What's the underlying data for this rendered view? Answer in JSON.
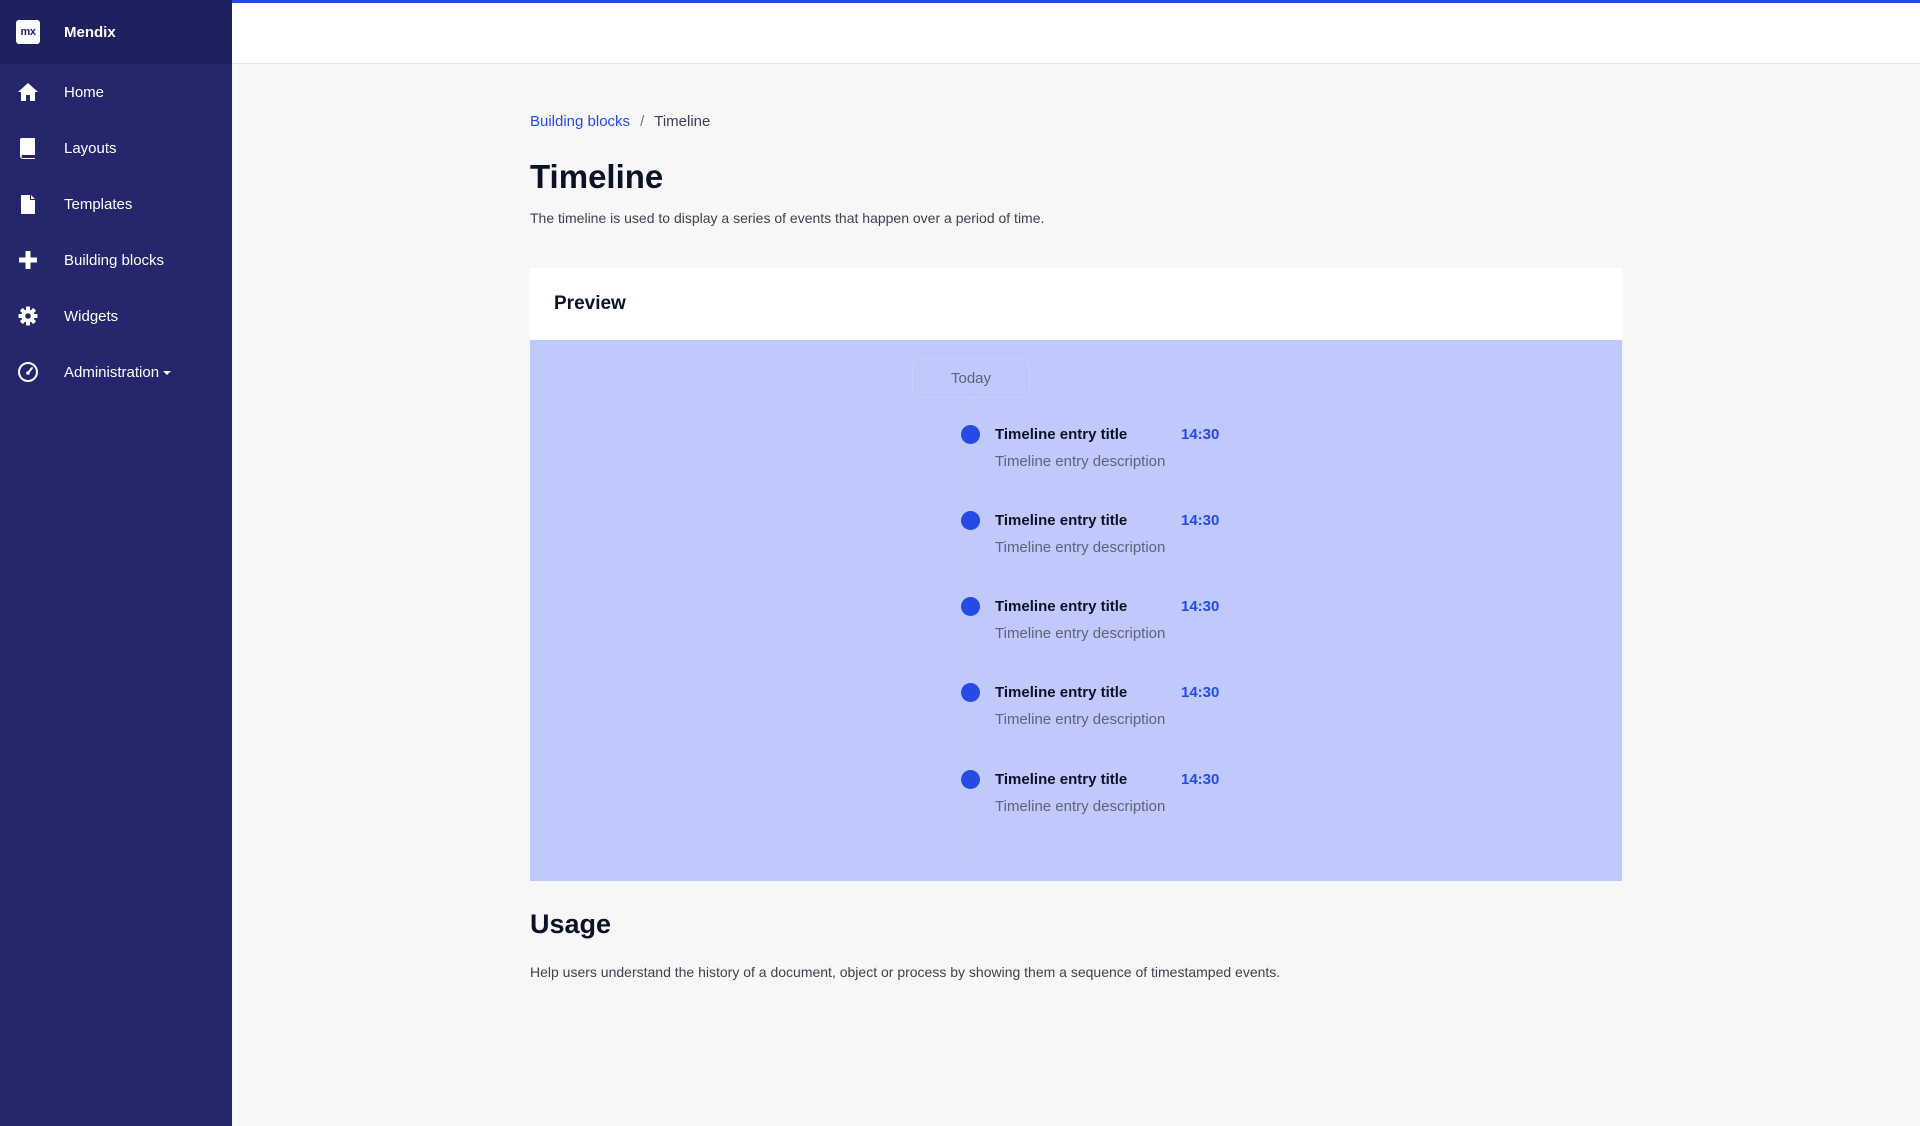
{
  "sidebar": {
    "brand": {
      "logo_text": "mx",
      "name": "Mendix"
    },
    "items": [
      {
        "label": "Home",
        "icon": "home-icon"
      },
      {
        "label": "Layouts",
        "icon": "book-icon"
      },
      {
        "label": "Templates",
        "icon": "file-icon"
      },
      {
        "label": "Building blocks",
        "icon": "plus-icon"
      },
      {
        "label": "Widgets",
        "icon": "gear-icon"
      },
      {
        "label": "Administration",
        "icon": "dashboard-icon",
        "has_dropdown": true
      }
    ]
  },
  "breadcrumb": {
    "parent": "Building blocks",
    "separator": "/",
    "current": "Timeline"
  },
  "page": {
    "title": "Timeline",
    "description": "The timeline is used to display a series of events that happen over a period of time."
  },
  "preview": {
    "header": "Preview",
    "day_label": "Today",
    "entries": [
      {
        "title": "Timeline entry title",
        "time": "14:30",
        "description": "Timeline entry description"
      },
      {
        "title": "Timeline entry title",
        "time": "14:30",
        "description": "Timeline entry description"
      },
      {
        "title": "Timeline entry title",
        "time": "14:30",
        "description": "Timeline entry description"
      },
      {
        "title": "Timeline entry title",
        "time": "14:30",
        "description": "Timeline entry description"
      },
      {
        "title": "Timeline entry title",
        "time": "14:30",
        "description": "Timeline entry description"
      }
    ]
  },
  "usage": {
    "title": "Usage",
    "description": "Help users understand the history of a document, object or process by showing them a sequence of timestamped events."
  },
  "colors": {
    "sidebar_bg": "#24276c",
    "brand_bg": "#1d2160",
    "accent": "#264ae5",
    "preview_bg": "#bfc9fb"
  }
}
